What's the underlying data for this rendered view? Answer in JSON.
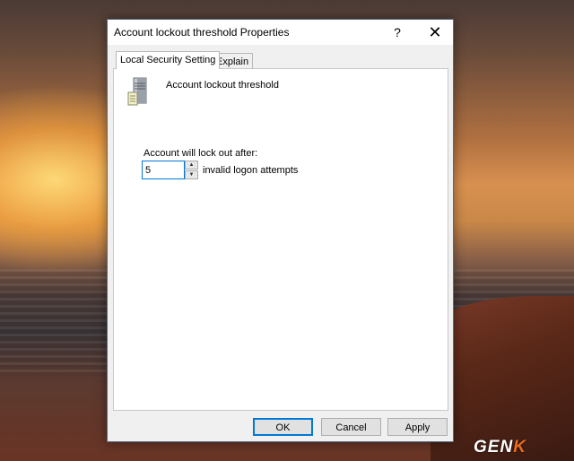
{
  "dialog": {
    "title": "Account lockout threshold Properties",
    "help_label": "?",
    "close_label": "✕",
    "tabs": [
      {
        "label": "Local Security Setting",
        "active": true
      },
      {
        "label": "Explain",
        "active": false
      }
    ],
    "policy_name": "Account lockout threshold",
    "icon": "server-icon",
    "lockout_label": "Account will lock out after:",
    "threshold_value": "5",
    "attempts_label": "invalid logon attempts",
    "buttons": {
      "ok": "OK",
      "cancel": "Cancel",
      "apply": "Apply"
    }
  },
  "watermark": {
    "main": "GEN",
    "accent": "K"
  },
  "colors": {
    "accent": "#0078d7",
    "watermark_accent": "#e86b1f"
  }
}
